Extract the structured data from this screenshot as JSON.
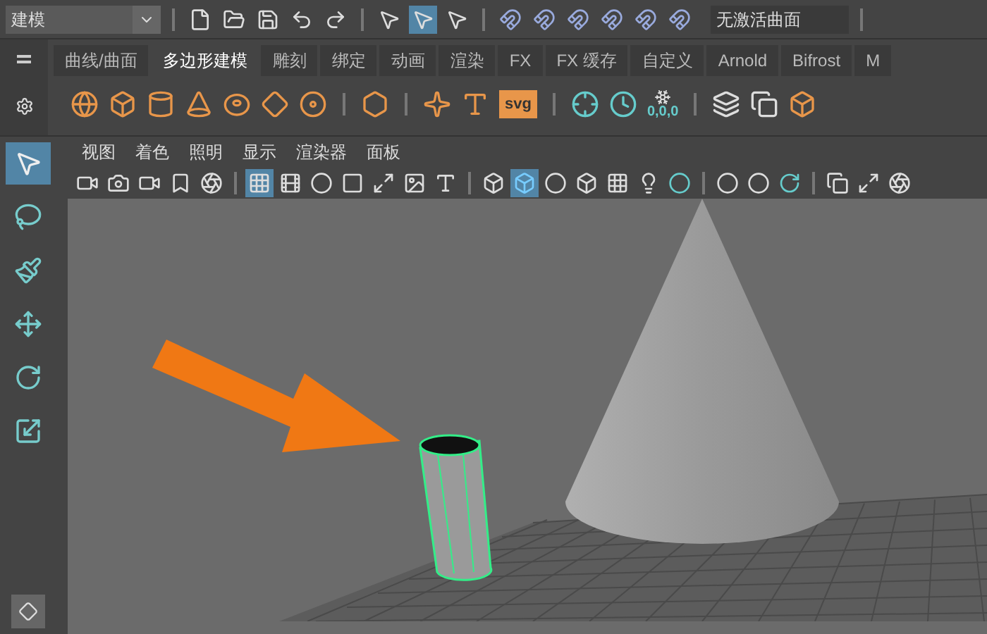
{
  "top_bar": {
    "mode": "建模",
    "selection_modes": [
      {
        "selected": false
      },
      {
        "selected": true
      },
      {
        "selected": false
      }
    ],
    "curve_field": "无激活曲面"
  },
  "shelf": {
    "tabs": [
      {
        "label": "曲线/曲面",
        "selected": false
      },
      {
        "label": "多边形建模",
        "selected": true
      },
      {
        "label": "雕刻",
        "selected": false
      },
      {
        "label": "绑定",
        "selected": false
      },
      {
        "label": "动画",
        "selected": false
      },
      {
        "label": "渲染",
        "selected": false
      },
      {
        "label": "FX",
        "selected": false
      },
      {
        "label": "FX 缓存",
        "selected": false
      },
      {
        "label": "自定义",
        "selected": false
      },
      {
        "label": "Arnold",
        "selected": false
      },
      {
        "label": "Bifrost",
        "selected": false
      },
      {
        "label": "M",
        "selected": false
      }
    ],
    "svg_label": "svg",
    "snow_label": "0,0,0"
  },
  "toolbox": [
    {
      "kind": "select",
      "selected": true
    },
    {
      "kind": "lasso",
      "selected": false
    },
    {
      "kind": "paint",
      "selected": false
    },
    {
      "kind": "move",
      "selected": false
    },
    {
      "kind": "rotate",
      "selected": false
    },
    {
      "kind": "scale",
      "selected": false
    }
  ],
  "panel": {
    "menu": [
      "视图",
      "着色",
      "照明",
      "显示",
      "渲染器",
      "面板"
    ],
    "view_toggles": [
      {
        "kind": "grid",
        "selected": true
      },
      {
        "kind": "film",
        "selected": false
      },
      {
        "kind": "circle",
        "selected": false
      },
      {
        "kind": "dark",
        "selected": false
      },
      {
        "kind": "frame",
        "selected": false
      },
      {
        "kind": "image",
        "selected": false
      },
      {
        "kind": "text",
        "selected": false
      }
    ],
    "shading": [
      {
        "kind": "wire",
        "selected": false
      },
      {
        "kind": "shaded",
        "selected": true
      },
      {
        "kind": "half",
        "selected": false
      },
      {
        "kind": "wire",
        "selected": false
      },
      {
        "kind": "checker",
        "selected": false
      }
    ]
  },
  "viewport": {
    "objects": [
      {
        "kind": "cone",
        "selected": false
      },
      {
        "kind": "cylinder",
        "selected": true
      }
    ]
  }
}
